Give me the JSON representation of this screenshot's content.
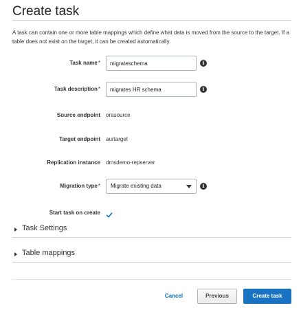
{
  "page": {
    "title": "Create task",
    "intro": "A task can contain one or more table mappings which define what data is moved from the source to the target. If a table does not exist on the target, it can be created automatically."
  },
  "form": {
    "task_name": {
      "label": "Task name",
      "required": "*",
      "value": "migrateschema"
    },
    "task_description": {
      "label": "Task description",
      "required": "*",
      "value": "migrates HR schema"
    },
    "source_endpoint": {
      "label": "Source endpoint",
      "value": "orasource"
    },
    "target_endpoint": {
      "label": "Target endpoint",
      "value": "aurtarget"
    },
    "replication_instance": {
      "label": "Replication instance",
      "value": "dmsdemo-repserver"
    },
    "migration_type": {
      "label": "Migration type",
      "required": "*",
      "selected": "Migrate existing data"
    },
    "start_task": {
      "label": "Start task on create",
      "checked": true
    }
  },
  "sections": {
    "task_settings": "Task Settings",
    "table_mappings": "Table mappings"
  },
  "footer": {
    "cancel": "Cancel",
    "previous": "Previous",
    "create": "Create task"
  },
  "colors": {
    "primary": "#1a73c2",
    "link": "#0073bb"
  },
  "icons": {
    "info": "info-icon",
    "checkmark": "checkmark-icon",
    "caret_down": "caret-down-icon",
    "caret_right": "caret-right-icon"
  }
}
